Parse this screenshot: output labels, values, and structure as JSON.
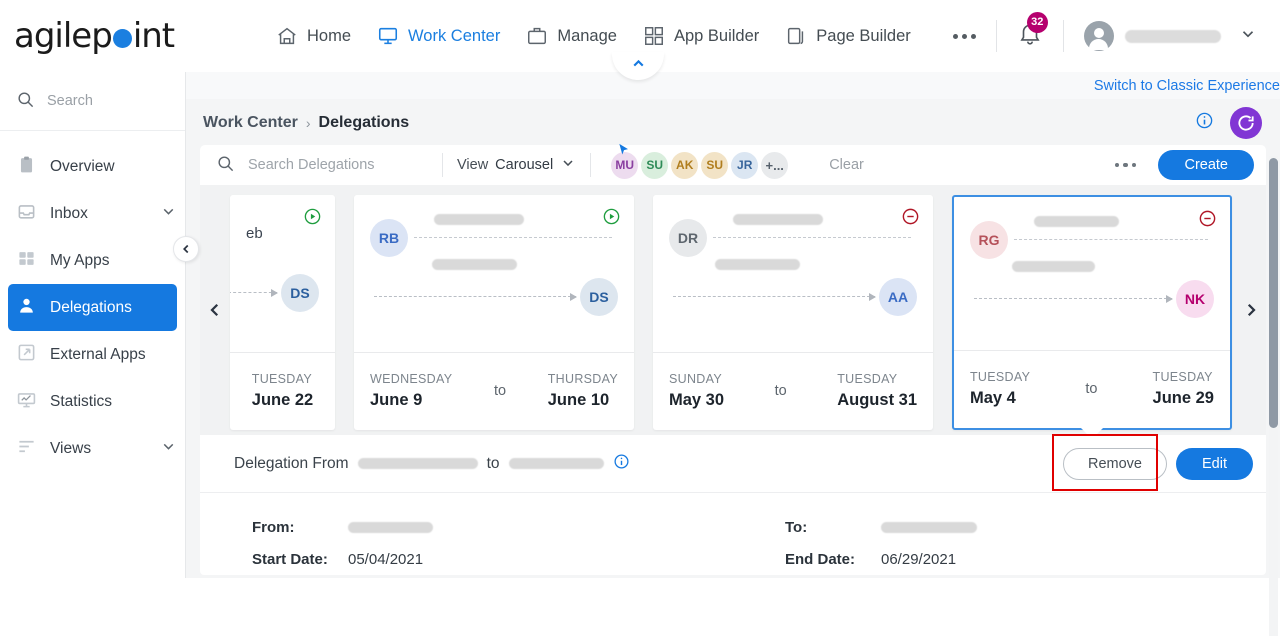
{
  "brand": {
    "name_part1": "agilep",
    "name_part2": "int"
  },
  "topnav": {
    "items": [
      {
        "label": "Home",
        "icon": "home-icon",
        "active": false
      },
      {
        "label": "Work Center",
        "icon": "monitor-icon",
        "active": true
      },
      {
        "label": "Manage",
        "icon": "briefcase-icon",
        "active": false
      },
      {
        "label": "App Builder",
        "icon": "grid-icon",
        "active": false
      },
      {
        "label": "Page Builder",
        "icon": "pages-icon",
        "active": false
      }
    ],
    "more_label": "...",
    "notification_count": "32",
    "user_name_redacted": true
  },
  "sidebar": {
    "search_placeholder": "Search",
    "items": [
      {
        "label": "Overview",
        "icon": "clipboard-icon",
        "chevron": false,
        "active": false
      },
      {
        "label": "Inbox",
        "icon": "inbox-icon",
        "chevron": true,
        "active": false
      },
      {
        "label": "My Apps",
        "icon": "apps-grid-icon",
        "chevron": false,
        "active": false
      },
      {
        "label": "Delegations",
        "icon": "person-icon",
        "chevron": false,
        "active": true
      },
      {
        "label": "External Apps",
        "icon": "external-link-icon",
        "chevron": false,
        "active": false
      },
      {
        "label": "Statistics",
        "icon": "chart-monitor-icon",
        "chevron": false,
        "active": false
      },
      {
        "label": "Views",
        "icon": "list-lines-icon",
        "chevron": true,
        "active": false
      }
    ]
  },
  "header": {
    "classic_link": "Switch to Classic Experience",
    "breadcrumb_root": "Work Center",
    "breadcrumb_sep": "›",
    "breadcrumb_current": "Delegations"
  },
  "toolbar": {
    "search_placeholder": "Search Delegations",
    "view_label": "View",
    "view_value": "Carousel",
    "clear_label": "Clear",
    "create_label": "Create",
    "chips": [
      {
        "initials": "MU",
        "bg": "#eddcef",
        "fg": "#8a3fa0"
      },
      {
        "initials": "SU",
        "bg": "#d9eedd",
        "fg": "#2e8b57"
      },
      {
        "initials": "AK",
        "bg": "#f2e3c6",
        "fg": "#b07d1d"
      },
      {
        "initials": "SU",
        "bg": "#f2e3c6",
        "fg": "#b07d1d"
      },
      {
        "initials": "JR",
        "bg": "#dbe6f2",
        "fg": "#37659c"
      },
      {
        "initials": "+...",
        "bg": "#e8eaec",
        "fg": "#55606b"
      }
    ]
  },
  "carousel": {
    "prev_label": "‹",
    "next_label": "›",
    "cards": [
      {
        "partial": true,
        "partial_text": "eb",
        "status": "active",
        "to_initials": "DS",
        "to_bg": "#dde6ef",
        "to_fg": "#2b5f9e",
        "start_day": "TUESDAY",
        "start_date": "June 22",
        "to_word": "",
        "end_day": "",
        "end_date": "",
        "selected": false
      },
      {
        "partial": false,
        "status": "active",
        "from_initials": "RB",
        "from_bg": "#dbe4f5",
        "from_fg": "#3a6bc4",
        "to_initials": "DS",
        "to_bg": "#dde6ef",
        "to_fg": "#2b5f9e",
        "start_day": "WEDNESDAY",
        "start_date": "June 9",
        "to_word": "to",
        "end_day": "THURSDAY",
        "end_date": "June 10",
        "selected": false
      },
      {
        "partial": false,
        "status": "inactive",
        "from_initials": "DR",
        "from_bg": "#e7e9eb",
        "from_fg": "#5e666e",
        "to_initials": "AA",
        "to_bg": "#dbe4f5",
        "to_fg": "#3a6bc4",
        "start_day": "SUNDAY",
        "start_date": "May 30",
        "to_word": "to",
        "end_day": "TUESDAY",
        "end_date": "August 31",
        "selected": false
      },
      {
        "partial": false,
        "status": "inactive",
        "from_initials": "RG",
        "from_bg": "#f7e2e4",
        "from_fg": "#b5515a",
        "to_initials": "NK",
        "to_bg": "#f8dcef",
        "to_fg": "#b5006e",
        "start_day": "TUESDAY",
        "start_date": "May 4",
        "to_word": "to",
        "end_day": "TUESDAY",
        "end_date": "June 29",
        "selected": true
      }
    ]
  },
  "detail": {
    "title_prefix": "Delegation From",
    "title_mid": "to",
    "remove_label": "Remove",
    "edit_label": "Edit",
    "from_label": "From:",
    "to_label": "To:",
    "start_date_label": "Start Date:",
    "start_date_value": "05/04/2021",
    "end_date_label": "End Date:",
    "end_date_value": "06/29/2021"
  },
  "colors": {
    "accent_blue": "#1579e0",
    "purple": "#8136d4",
    "badge_magenta": "#b5006e",
    "status_active_green": "#1f9d3f",
    "status_inactive_red": "#b01626",
    "highlight_red": "#e00000"
  }
}
